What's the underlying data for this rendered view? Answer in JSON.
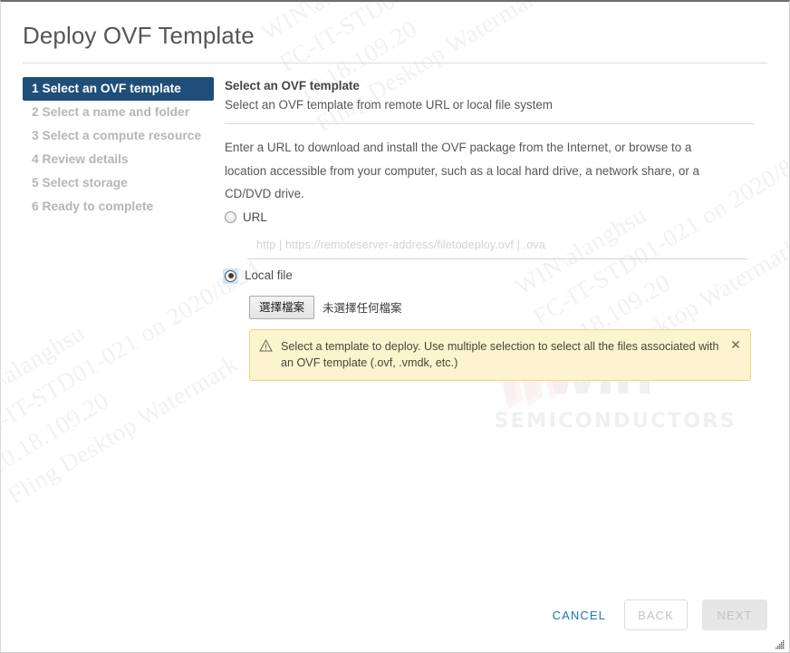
{
  "window": {
    "title": "Deploy OVF Template"
  },
  "steps": [
    {
      "label": "1 Select an OVF template",
      "state": "active"
    },
    {
      "label": "2 Select a name and folder",
      "state": "inactive"
    },
    {
      "label": "3 Select a compute resource",
      "state": "inactive"
    },
    {
      "label": "4 Review details",
      "state": "inactive"
    },
    {
      "label": "5 Select storage",
      "state": "inactive"
    },
    {
      "label": "6 Ready to complete",
      "state": "inactive"
    }
  ],
  "pane": {
    "heading": "Select an OVF template",
    "subheading": "Select an OVF template from remote URL or local file system",
    "paragraph": "Enter a URL to download and install the OVF package from the Internet, or browse to a location accessible from your computer, such as a local hard drive, a network share, or a CD/DVD drive."
  },
  "source_options": {
    "url": {
      "label": "URL",
      "selected": false,
      "input_value": "",
      "input_placeholder": "http | https://remoteserver-address/filetodeploy.ovf | .ova"
    },
    "local_file": {
      "label": "Local file",
      "selected": true,
      "choose_button_label": "選擇檔案",
      "no_file_text": "未選擇任何檔案"
    }
  },
  "warning": {
    "icon": "warning-triangle-icon",
    "text": "Select a template to deploy. Use multiple selection to select all the files associated with an OVF template (.ovf, .vmdk, etc.)",
    "close_label": "✕",
    "background_color": "#FCF3CF",
    "border_color": "#F0D77B"
  },
  "footer": {
    "cancel_label": "CANCEL",
    "back_label": "BACK",
    "next_label": "NEXT",
    "back_disabled": true,
    "next_disabled": true,
    "cancel_color": "#1576BC"
  },
  "watermark": {
    "line1": "WIN\\alanghsu",
    "line2": "FC-IT-STD01-021 on 2020/8/24",
    "line3": "10.18.109.20",
    "line4": "Fling Desktop Watermark",
    "logo_word": "win",
    "logo_sub": "SEMICONDUCTORS"
  },
  "colors": {
    "active_step": "#1F4E79",
    "accent": "#1576BC",
    "warning_bg": "#FCF3CF"
  }
}
